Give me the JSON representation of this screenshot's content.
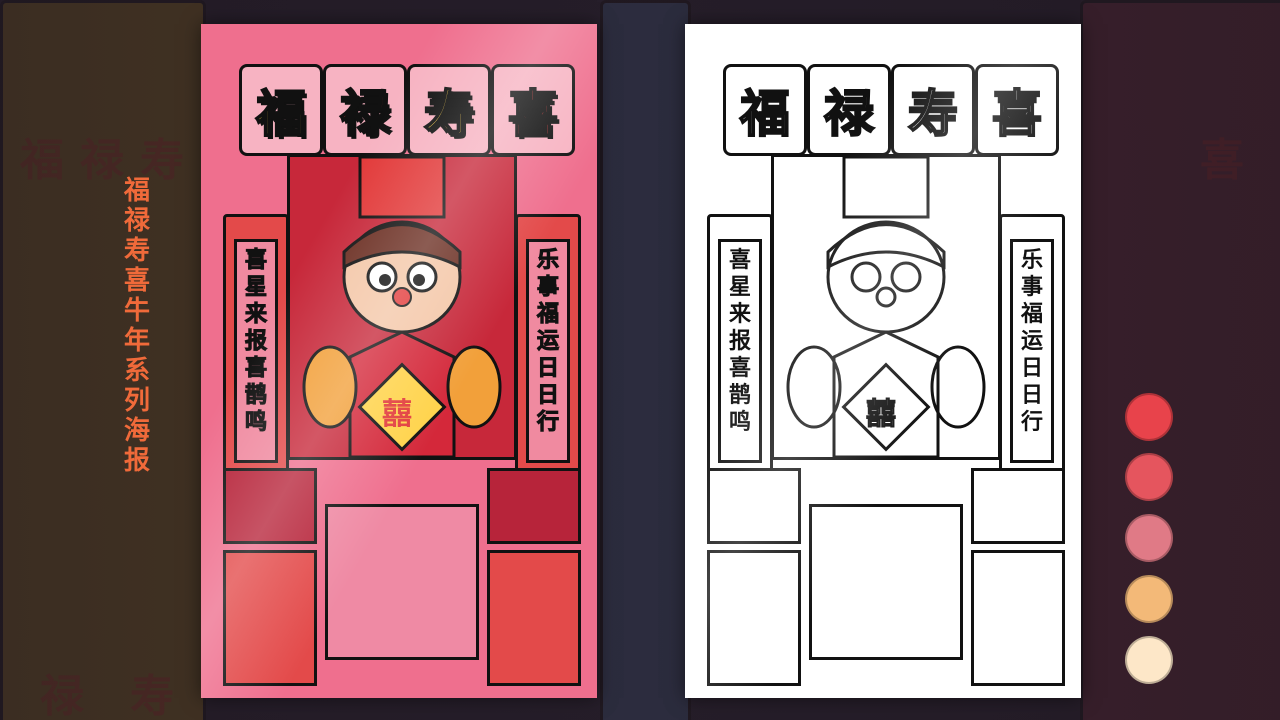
{
  "side_title": "福禄寿喜牛年系列海报",
  "poster_titles": [
    "福",
    "禄",
    "寿",
    "喜"
  ],
  "couplet_left": "喜星来报喜鹊鸣",
  "couplet_right": "乐事福运日日行",
  "center_emblem": "囍",
  "background_chars": [
    "福",
    "禄",
    "寿",
    "喜"
  ],
  "palette": [
    "#e8434b",
    "#e5555e",
    "#e07a86",
    "#f3b978",
    "#fde7c8"
  ],
  "colors": {
    "poster_bg": "#ef6f8e",
    "accent_gold": "#ffd34a",
    "accent_red": "#e23a3a",
    "title_orange": "#f06a3a"
  }
}
